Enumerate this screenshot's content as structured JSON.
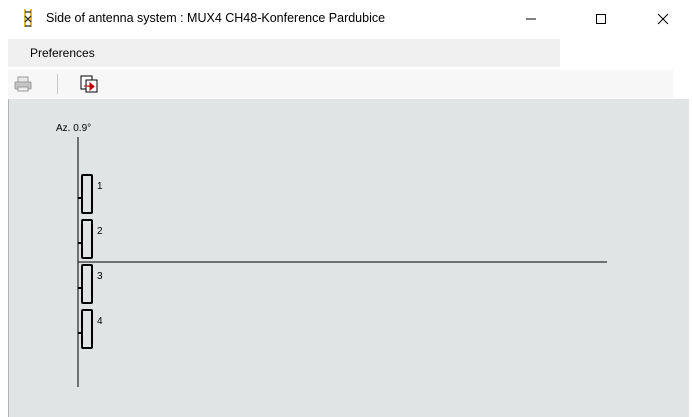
{
  "window": {
    "title": "Side of antenna system : MUX4 CH48-Konference Pardubice",
    "icon": "antenna-tower-icon",
    "controls": [
      "minimize-icon",
      "maximize-icon",
      "close-icon"
    ]
  },
  "menu": {
    "items": [
      {
        "label": "Preferences"
      }
    ]
  },
  "toolbar": {
    "buttons": [
      {
        "icon": "print-icon",
        "enabled": false
      },
      {
        "icon": "export-icon",
        "enabled": true
      }
    ]
  },
  "diagram": {
    "azimuth_label": "Az. 0.9°",
    "antennas": [
      {
        "label": "1"
      },
      {
        "label": "2"
      },
      {
        "label": "3"
      },
      {
        "label": "4"
      }
    ]
  }
}
